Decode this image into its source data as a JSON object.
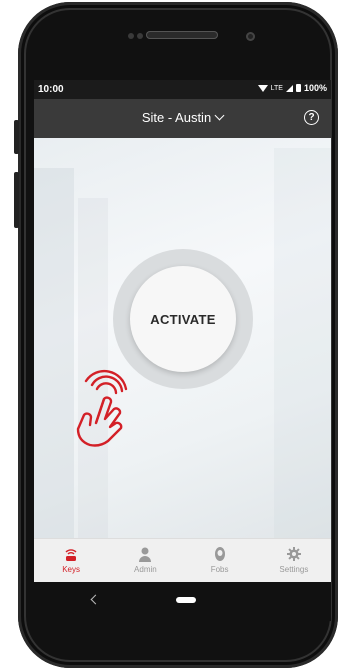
{
  "status_bar": {
    "time": "10:00",
    "network": "LTE",
    "battery": "100%"
  },
  "app_bar": {
    "site_label": "Site - Austin",
    "help_icon": "help-circle-icon"
  },
  "main": {
    "activate_label": "ACTIVATE"
  },
  "tabs": [
    {
      "label": "Keys",
      "icon": "keys-icon",
      "active": true
    },
    {
      "label": "Admin",
      "icon": "person-icon",
      "active": false
    },
    {
      "label": "Fobs",
      "icon": "fob-icon",
      "active": false
    },
    {
      "label": "Settings",
      "icon": "gear-icon",
      "active": false
    }
  ],
  "colors": {
    "accent": "#d32027",
    "appbar": "#3a3a3a",
    "tab_inactive": "#999999"
  }
}
